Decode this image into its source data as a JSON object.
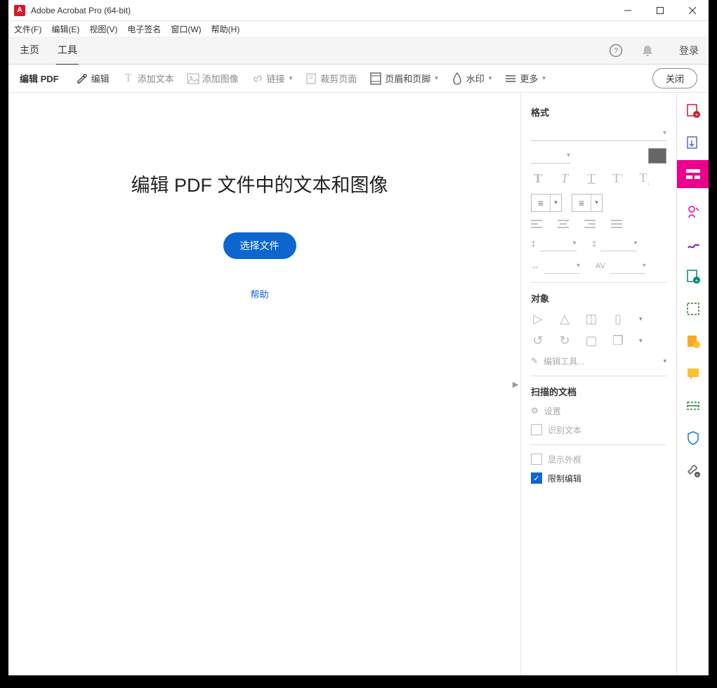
{
  "window": {
    "title": "Adobe Acrobat Pro (64-bit)"
  },
  "menu": {
    "file": "文件(F)",
    "edit": "编辑(E)",
    "view": "视图(V)",
    "esign": "电子签名",
    "window": "窗口(W)",
    "help": "帮助(H)"
  },
  "nav": {
    "home": "主页",
    "tools": "工具",
    "login": "登录"
  },
  "toolbar": {
    "label": "编辑 PDF",
    "edit": "编辑",
    "add_text": "添加文本",
    "add_image": "添加图像",
    "link": "链接",
    "crop": "裁剪页面",
    "header_footer": "页眉和页脚",
    "watermark": "水印",
    "more": "更多",
    "close": "关闭"
  },
  "canvas": {
    "heading": "编辑 PDF 文件中的文本和图像",
    "select_file": "选择文件",
    "help": "帮助"
  },
  "panel": {
    "format_title": "格式",
    "object_title": "对象",
    "edit_tools": "编辑工具...",
    "scanned_title": "扫描的文档",
    "settings": "设置",
    "recognize_text": "识别文本",
    "show_outline": "显示外框",
    "restrict_edit": "限制编辑"
  }
}
